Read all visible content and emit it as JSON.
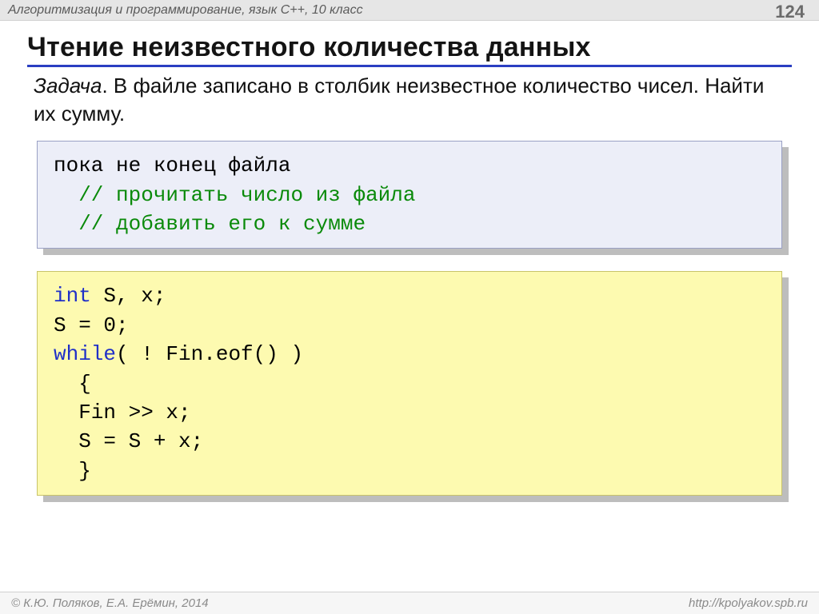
{
  "header": {
    "course": "Алгоритмизация и программирование, язык С++, 10 класс",
    "page": "124"
  },
  "title": "Чтение неизвестного количества данных",
  "task": {
    "label": "Задача",
    "text": ". В файле записано в столбик неизвестное количество чисел. Найти их сумму."
  },
  "pseudo": {
    "line1": "пока не конец файла",
    "line2": "  // прочитать число из файла",
    "line3": "  // добавить его к сумме"
  },
  "code": {
    "kw_int": "int",
    "decl_rest": " S, x;",
    "l2": "S = 0;",
    "kw_while": "while",
    "cond_rest": "( ! Fin.eof() )",
    "l4": "  {",
    "l5": "  Fin >> x;",
    "l6": "  S = S + x;",
    "l7": "  }"
  },
  "footer": {
    "left": "© К.Ю. Поляков, Е.А. Ерёмин, 2014",
    "right": "http://kpolyakov.spb.ru"
  }
}
